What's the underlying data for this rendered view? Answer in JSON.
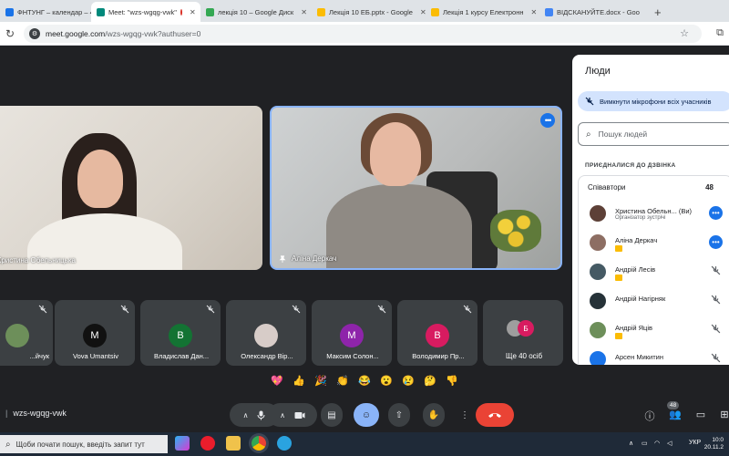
{
  "browser": {
    "tabs": [
      {
        "label": "ФНТУНГ – календар – 4 д",
        "color": "#1a73e8",
        "active": false
      },
      {
        "label": "Meet: \"wzs-wgqg-vwk\"",
        "color": "#00897b",
        "active": true
      },
      {
        "label": "лекція 10 – Google Диск",
        "color": "#34a853",
        "active": false
      },
      {
        "label": "Лекція 10 ЕБ.pptx - Google",
        "color": "#fbbc04",
        "active": false
      },
      {
        "label": "Лекція 1 курсу Електронн",
        "color": "#fbbc04",
        "active": false
      },
      {
        "label": "ВІДСКАНУЙТЕ.docx - Goo",
        "color": "#4285f4",
        "active": false
      }
    ],
    "new_tab": "+",
    "url_host": "meet.google.com",
    "url_path": "/wzs-wgqg-vwk?authuser=0"
  },
  "stage": {
    "main_tiles": [
      {
        "name": "Христина Обельницька"
      },
      {
        "name": "Аліна Деркач"
      }
    ],
    "small_tiles": [
      {
        "name": "...йчук",
        "avatar": "",
        "color": "#5f6368"
      },
      {
        "name": "Vova Umantsiv",
        "avatar": "M",
        "color": "#111111"
      },
      {
        "name": "Владислав Дан...",
        "avatar": "B",
        "color": "#137333"
      },
      {
        "name": "Олександр Вір...",
        "avatar": "",
        "color": "#e8eaed"
      },
      {
        "name": "Максим Солон...",
        "avatar": "M",
        "color": "#8e24aa"
      },
      {
        "name": "Володимир Пр...",
        "avatar": "B",
        "color": "#d81b60"
      },
      {
        "name": "Ще 40 осіб",
        "avatar": "Б",
        "color": "#d81b60"
      }
    ],
    "reactions": [
      "💖",
      "👍",
      "🎉",
      "👏",
      "😂",
      "😮",
      "😢",
      "🤔",
      "👎"
    ]
  },
  "controls": {
    "meeting_code": "wzs-wgqg-vwk",
    "people_count": "48"
  },
  "panel": {
    "title": "Люди",
    "mute_all": "Вимкнути мікрофони всіх учасників",
    "search_placeholder": "Пошук людей",
    "section": "ПРИЄДНАЛИСЯ ДО ДЗВІНКА",
    "group_label": "Співавтори",
    "group_count": "48",
    "people": [
      {
        "name": "Христина Обельн...  (Ви)",
        "role": "Організатор зустрічі",
        "avatar_color": "#5d4037",
        "action": "more",
        "hand": false
      },
      {
        "name": "Аліна Деркач",
        "role": "",
        "avatar_color": "#8d6e63",
        "action": "more",
        "hand": true
      },
      {
        "name": "Андрій Лесів",
        "role": "",
        "avatar_color": "#455a64",
        "action": "muted",
        "hand": true
      },
      {
        "name": "Андрій Нагірняк",
        "role": "",
        "avatar_color": "#263238",
        "action": "muted",
        "hand": false
      },
      {
        "name": "Андрій Яців",
        "role": "",
        "avatar_color": "#6d8f5a",
        "action": "muted",
        "hand": true
      },
      {
        "name": "Арсен Микитин",
        "role": "",
        "avatar_color": "#1a73e8",
        "action": "muted",
        "hand": false
      }
    ]
  },
  "taskbar": {
    "search": "Щоби почати пошук, введіть запит тут",
    "lang": "УКР",
    "time": "10:0",
    "date": "20.11.2"
  }
}
